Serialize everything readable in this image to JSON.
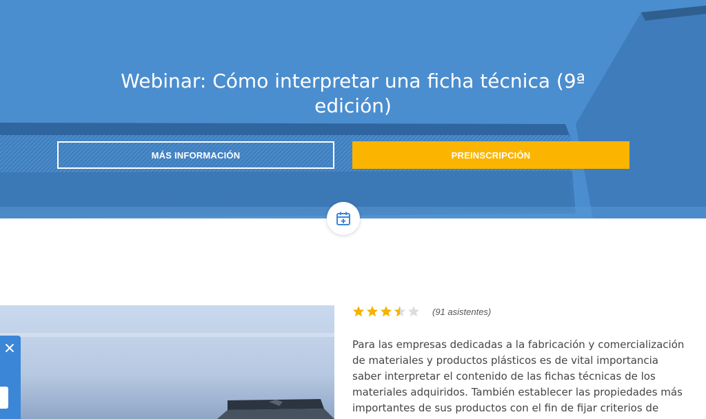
{
  "hero": {
    "title": "Webinar: Cómo interpretar una ficha técnica (9ª edición)",
    "more_info_label": "MÁS INFORMACIÓN",
    "preregister_label": "PREINSCRIPCIÓN"
  },
  "calendar": {
    "icon": "calendar-plus-icon"
  },
  "rating": {
    "value": 3.5,
    "max": 5,
    "attendees": "(91 asistentes)"
  },
  "description": "Para las empresas dedicadas a la fabricación y comercialización de materiales y productos plásticos es de vital importancia saber interpretar el contenido de las fichas técnicas de los materiales adquiridos. También establecer las propiedades más importantes de sus productos con el fin de fijar criterios de calidad adecuados.",
  "side_panel": {
    "close_icon": "close-icon"
  },
  "colors": {
    "hero_blue": "#4a8ccc",
    "accent_yellow": "#fbb500",
    "star_filled": "#f5b400",
    "star_empty": "#dddddd",
    "panel_blue": "#3b86d6"
  }
}
